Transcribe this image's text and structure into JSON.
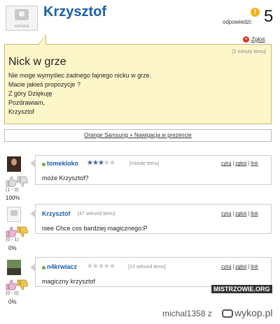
{
  "question": {
    "author": "Krzysztof",
    "avatar_caption": "samosa",
    "answers_label": "odpowiedzi:",
    "answers_count": "5",
    "report_label": "Zgłoś",
    "time": "[2 minuty temu]",
    "title": "Nick w grze",
    "body_lines": [
      "Nie moge wymyślec żadnego fajnego nicku w grze.",
      "Macie jakieś propozycje ?",
      "Z góry Dziękuję",
      "Pozdrawiam,",
      "Krzysztof"
    ]
  },
  "ad_link": "Orange Samsung + Nawigacja w prezencie",
  "answers": [
    {
      "author": "tomekloko",
      "rating": 3.5,
      "time": "[minutę temu]",
      "text": "może Krzysztof?",
      "links": [
        "cytuj",
        "zgłoś",
        "link"
      ],
      "votes": "(1 - 0)",
      "percent": "100%"
    },
    {
      "author": "Krzysztof",
      "time": "[47 sekund temu]",
      "text": "niee Chce cos bardziej magicznego:P",
      "links": [
        "cytuj",
        "zgłoś",
        "link"
      ],
      "votes": "(0 - 1)",
      "percent": "0%"
    },
    {
      "author": "n4krwiacz",
      "rating": 0,
      "time": "[13 sekund temu]",
      "text": "magiczny krzysztof",
      "links": [
        "cytuj",
        "zgłoś",
        "link"
      ],
      "votes": "(0 - 0)",
      "percent": "0%"
    }
  ],
  "watermark": "MISTRZOWIE.ORG",
  "footer": {
    "user": "michal1358",
    "connector": "z",
    "site": "wykop.pl"
  },
  "colors": {
    "question_bg": "#fdf6c9",
    "link_blue": "#1b5fa8",
    "star_on": "#3a5f9e",
    "online_dot": "#6aa83a"
  }
}
